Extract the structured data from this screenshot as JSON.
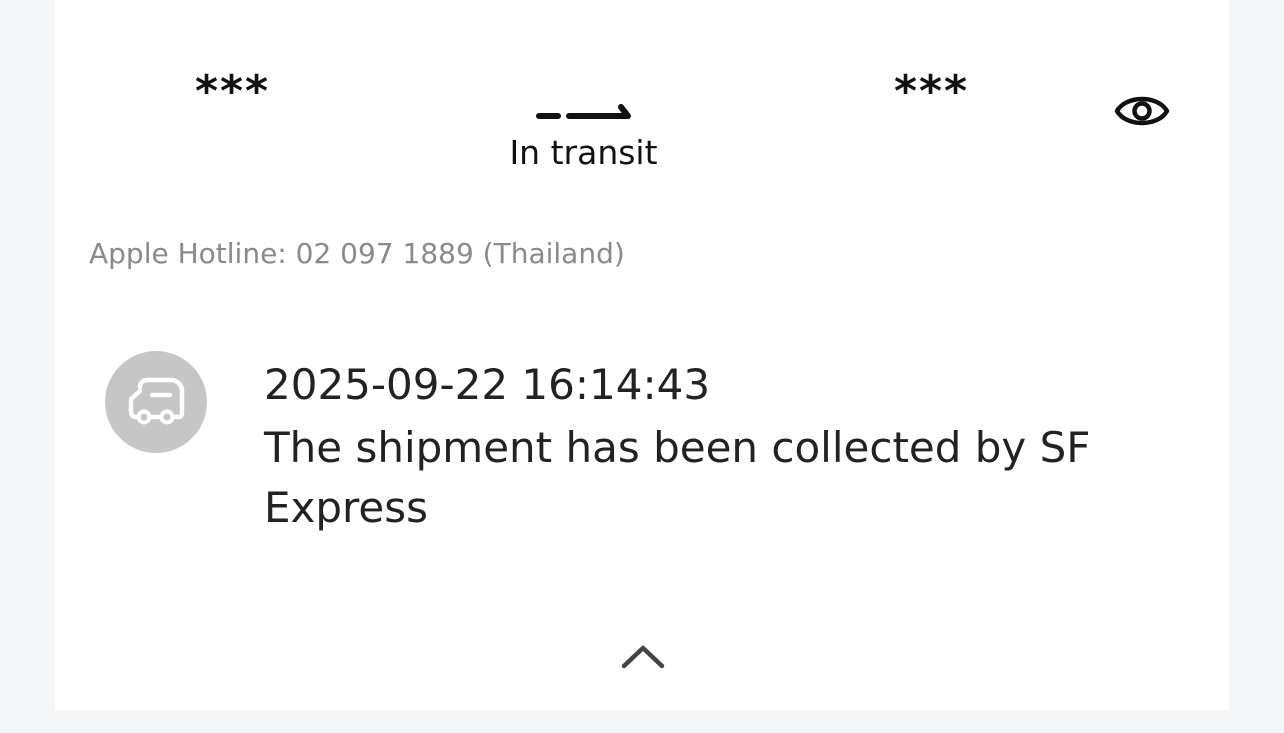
{
  "route": {
    "origin_masked": "***",
    "destination_masked": "***",
    "status": "In transit",
    "arrow_icon": "arrow-right-icon",
    "visibility_icon": "eye-icon"
  },
  "hotline": "Apple Hotline: 02 097 1889 (Thailand)",
  "tracking_events": [
    {
      "icon": "truck-icon",
      "timestamp": "2025-09-22 16:14:43",
      "description": "The shipment has been collected by SF Express"
    }
  ],
  "collapse_icon": "chevron-up-icon",
  "colors": {
    "page_background": "#f5f6f8",
    "card_background": "#ffffff",
    "primary_text": "#111111",
    "secondary_text": "#8a8a8a",
    "event_icon_background": "#c6c6c6"
  }
}
